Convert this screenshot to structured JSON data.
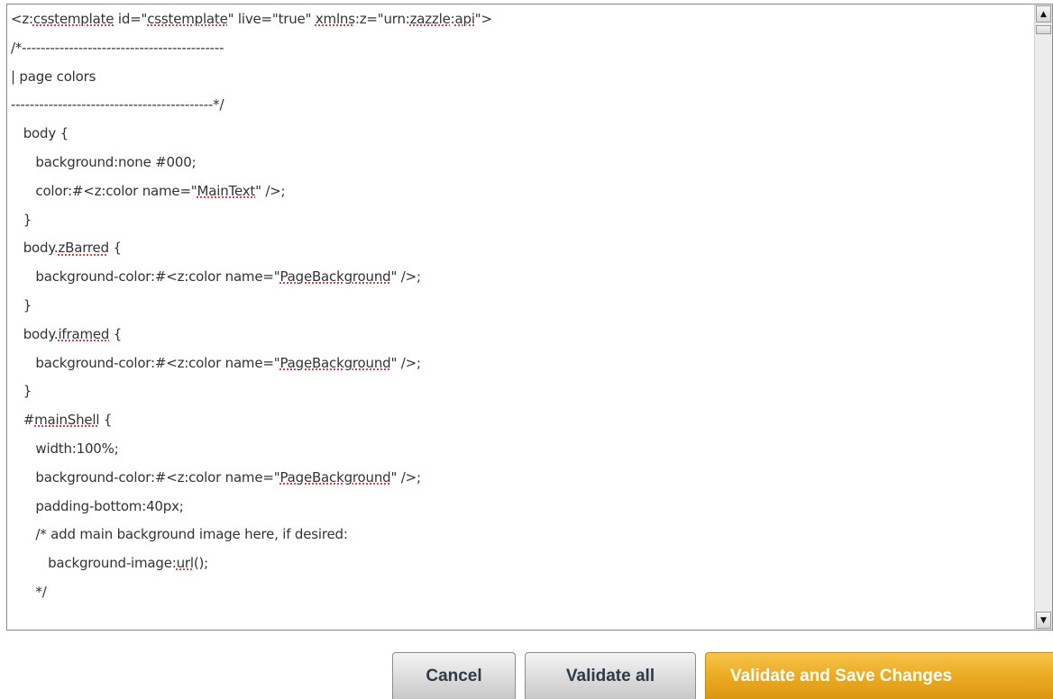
{
  "editor": {
    "lines": [
      {
        "parts": [
          {
            "t": "<z:"
          },
          {
            "t": "csstemplate",
            "u": true
          },
          {
            "t": " id=\""
          },
          {
            "t": "csstemplate",
            "u": true
          },
          {
            "t": "\" live=\"true\" "
          },
          {
            "t": "xmlns",
            "u": true
          },
          {
            "t": ":z=\"urn:"
          },
          {
            "t": "zazzle",
            "u": true
          },
          {
            "t": ":"
          },
          {
            "t": "api",
            "u": true
          },
          {
            "t": "\">"
          }
        ]
      },
      {
        "parts": [
          {
            "t": "/*-------------------------------------------"
          }
        ]
      },
      {
        "parts": [
          {
            "t": "| page colors"
          }
        ]
      },
      {
        "parts": [
          {
            "t": "-------------------------------------------*/"
          }
        ]
      },
      {
        "parts": [
          {
            "t": "   body {"
          }
        ]
      },
      {
        "parts": [
          {
            "t": "      background:none #000;"
          }
        ]
      },
      {
        "parts": [
          {
            "t": "      color:#<z:color name=\""
          },
          {
            "t": "MainText",
            "u": true
          },
          {
            "t": "\" />;"
          }
        ]
      },
      {
        "parts": [
          {
            "t": "   }"
          }
        ]
      },
      {
        "parts": [
          {
            "t": "   body."
          },
          {
            "t": "zBarred",
            "u": true
          },
          {
            "t": " {"
          }
        ]
      },
      {
        "parts": [
          {
            "t": "      background-color:#<z:color name=\""
          },
          {
            "t": "PageBackground",
            "u": true
          },
          {
            "t": "\" />;"
          }
        ]
      },
      {
        "parts": [
          {
            "t": "   }"
          }
        ]
      },
      {
        "parts": [
          {
            "t": "   body."
          },
          {
            "t": "iframed",
            "u": true
          },
          {
            "t": " {"
          }
        ]
      },
      {
        "parts": [
          {
            "t": "      background-color:#<z:color name=\""
          },
          {
            "t": "PageBackground",
            "u": true
          },
          {
            "t": "\" />;"
          }
        ]
      },
      {
        "parts": [
          {
            "t": "   }"
          }
        ]
      },
      {
        "parts": [
          {
            "t": "   #"
          },
          {
            "t": "mainShell",
            "u": true
          },
          {
            "t": " {"
          }
        ]
      },
      {
        "parts": [
          {
            "t": "      width:100%;"
          }
        ]
      },
      {
        "parts": [
          {
            "t": "      background-color:#<z:color name=\""
          },
          {
            "t": "PageBackground",
            "u": true
          },
          {
            "t": "\" />;"
          }
        ]
      },
      {
        "parts": [
          {
            "t": "      padding-bottom:40px;"
          }
        ]
      },
      {
        "parts": [
          {
            "t": "      /* add main background image here, if desired:"
          }
        ]
      },
      {
        "parts": [
          {
            "t": "         background-image:"
          },
          {
            "t": "url",
            "u": true
          },
          {
            "t": "();"
          }
        ]
      },
      {
        "parts": [
          {
            "t": "      */"
          }
        ]
      }
    ]
  },
  "scrollbar": {
    "up_icon": "triangle-up",
    "down_icon": "triangle-down"
  },
  "actions": {
    "cancel_label": "Cancel",
    "validate_label": "Validate all",
    "save_label": "Validate and Save Changes"
  },
  "colors": {
    "primary_button": "#eaa920",
    "secondary_button": "#dcdcdc",
    "spellcheck_underline": "#d40000"
  }
}
